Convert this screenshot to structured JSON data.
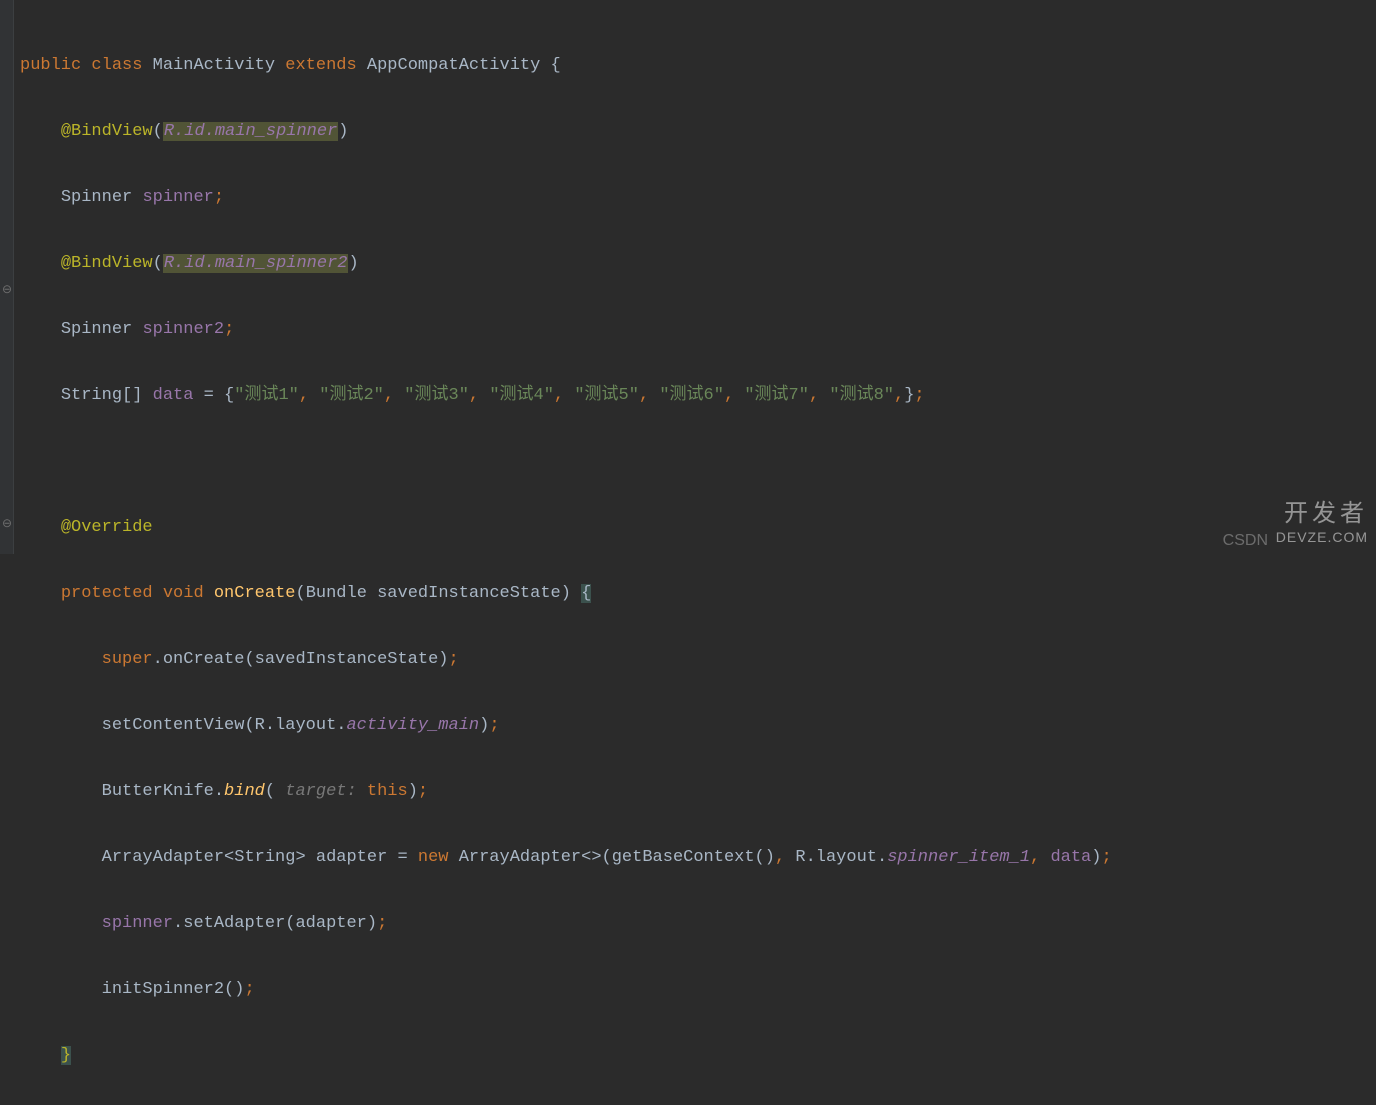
{
  "code": {
    "tokens": {
      "public": "public",
      "class": "class",
      "extends": "extends",
      "protected": "protected",
      "void": "void",
      "new": "new",
      "super": "super",
      "this": "this"
    },
    "identifiers": {
      "MainActivity": "MainActivity",
      "AppCompatActivity": "AppCompatActivity",
      "BindView": "@BindView",
      "R_id": "R.id.",
      "main_spinner": "main_spinner",
      "main_spinner2": "main_spinner2",
      "Spinner": "Spinner",
      "spinner": "spinner",
      "spinner2": "spinner2",
      "String_arr": "String[]",
      "data": "data",
      "Override": "@Override",
      "onCreate": "onCreate",
      "Bundle": "Bundle",
      "savedInstanceState": "savedInstanceState",
      "setContentView": "setContentView",
      "R_layout": "R.layout.",
      "activity_main": "activity_main",
      "ButterKnife": "ButterKnife",
      "bind": "bind",
      "target_hint": "target: ",
      "ArrayAdapter": "ArrayAdapter",
      "String": "String",
      "adapter": "adapter",
      "getBaseContext": "getBaseContext",
      "spinner_item_1": "spinner_item_1",
      "setAdapter": "setAdapter",
      "initSpinner2": "initSpinner2"
    },
    "strings": {
      "s1": "\"测试1\"",
      "s2": "\"测试2\"",
      "s3": "\"测试3\"",
      "s4": "\"测试4\"",
      "s5": "\"测试5\"",
      "s6": "\"测试6\"",
      "s7": "\"测试7\"",
      "s8": "\"测试8\""
    }
  },
  "watermark": {
    "cn": "开发者",
    "en": "DEVZE.COM",
    "csdn": "CSDN"
  }
}
